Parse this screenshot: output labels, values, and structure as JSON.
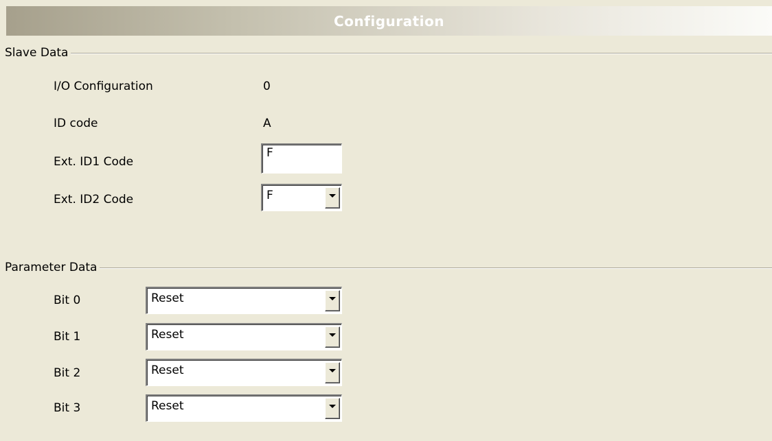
{
  "header": {
    "title": "Configuration"
  },
  "slave_data": {
    "section_label": "Slave Data",
    "fields": [
      {
        "label": "I/O Configuration",
        "value": "0"
      },
      {
        "label": "ID code",
        "value": "A"
      },
      {
        "label": "Ext. ID1 Code",
        "value": "F"
      },
      {
        "label": "Ext. ID2 Code",
        "value": "F"
      }
    ]
  },
  "parameter_data": {
    "section_label": "Parameter Data",
    "bits": [
      {
        "label": "Bit 0",
        "value": "Reset"
      },
      {
        "label": "Bit 1",
        "value": "Reset"
      },
      {
        "label": "Bit 2",
        "value": "Reset"
      },
      {
        "label": "Bit 3",
        "value": "Reset"
      }
    ]
  },
  "icons": {
    "dropdown": "chevron-down-icon"
  }
}
